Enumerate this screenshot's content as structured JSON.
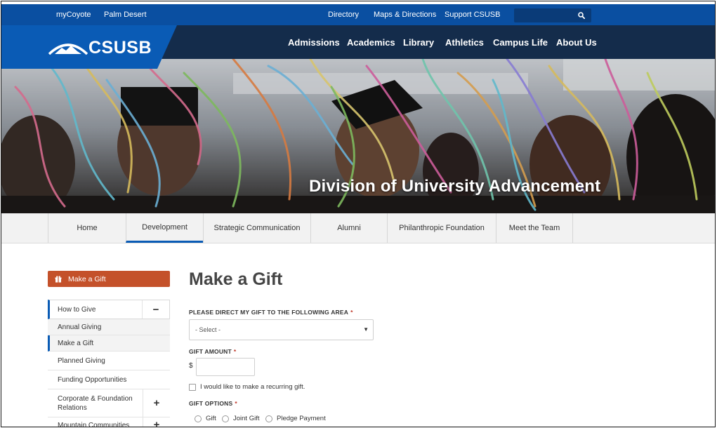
{
  "utility_nav": {
    "left_links": [
      "myCoyote",
      "Palm Desert"
    ],
    "right_links": [
      "Directory",
      "Maps & Directions",
      "Support CSUSB"
    ],
    "search": {
      "value": "",
      "icon": "search-icon"
    }
  },
  "brand": {
    "logo_text": "CSUSB",
    "logo_icon": "mountain-logo-icon"
  },
  "main_nav": [
    "Admissions",
    "Academics",
    "Library",
    "Athletics",
    "Campus Life",
    "About Us"
  ],
  "hero": {
    "title": "Division of University Advancement"
  },
  "sub_nav": {
    "tabs": [
      "Home",
      "Development",
      "Strategic Communication",
      "Alumni",
      "Philanthropic Foundation",
      "Meet the Team"
    ],
    "active": "Development"
  },
  "sidebar": {
    "make_gift": {
      "label": "Make a Gift",
      "icon": "gift-icon"
    },
    "items": [
      {
        "label": "How to Give",
        "toggle": "−"
      },
      {
        "label": "Annual Giving"
      },
      {
        "label": "Make a Gift"
      },
      {
        "label": "Planned Giving"
      },
      {
        "label": "Funding Opportunities"
      },
      {
        "label": "Corporate & Foundation Relations",
        "toggle": "+"
      },
      {
        "label": "Mountain Communities",
        "toggle": "+"
      }
    ]
  },
  "form": {
    "title": "Make a Gift",
    "direct_label": "PLEASE DIRECT MY GIFT TO THE FOLLOWING AREA",
    "required_mark": "*",
    "select_value": "- Select -",
    "amount_label": "GIFT AMOUNT",
    "currency": "$",
    "amount_value": "",
    "recurring_label": "I would like to make a recurring gift.",
    "options_label": "GIFT OPTIONS",
    "options": [
      "Gift",
      "Joint Gift",
      "Pledge Payment"
    ]
  },
  "colors": {
    "utility_bar": "#0a4fa1",
    "main_nav": "#142c4b",
    "logo_block": "#0a5bb5",
    "make_gift_button": "#c4512a",
    "active_accent": "#0a5bb5"
  }
}
